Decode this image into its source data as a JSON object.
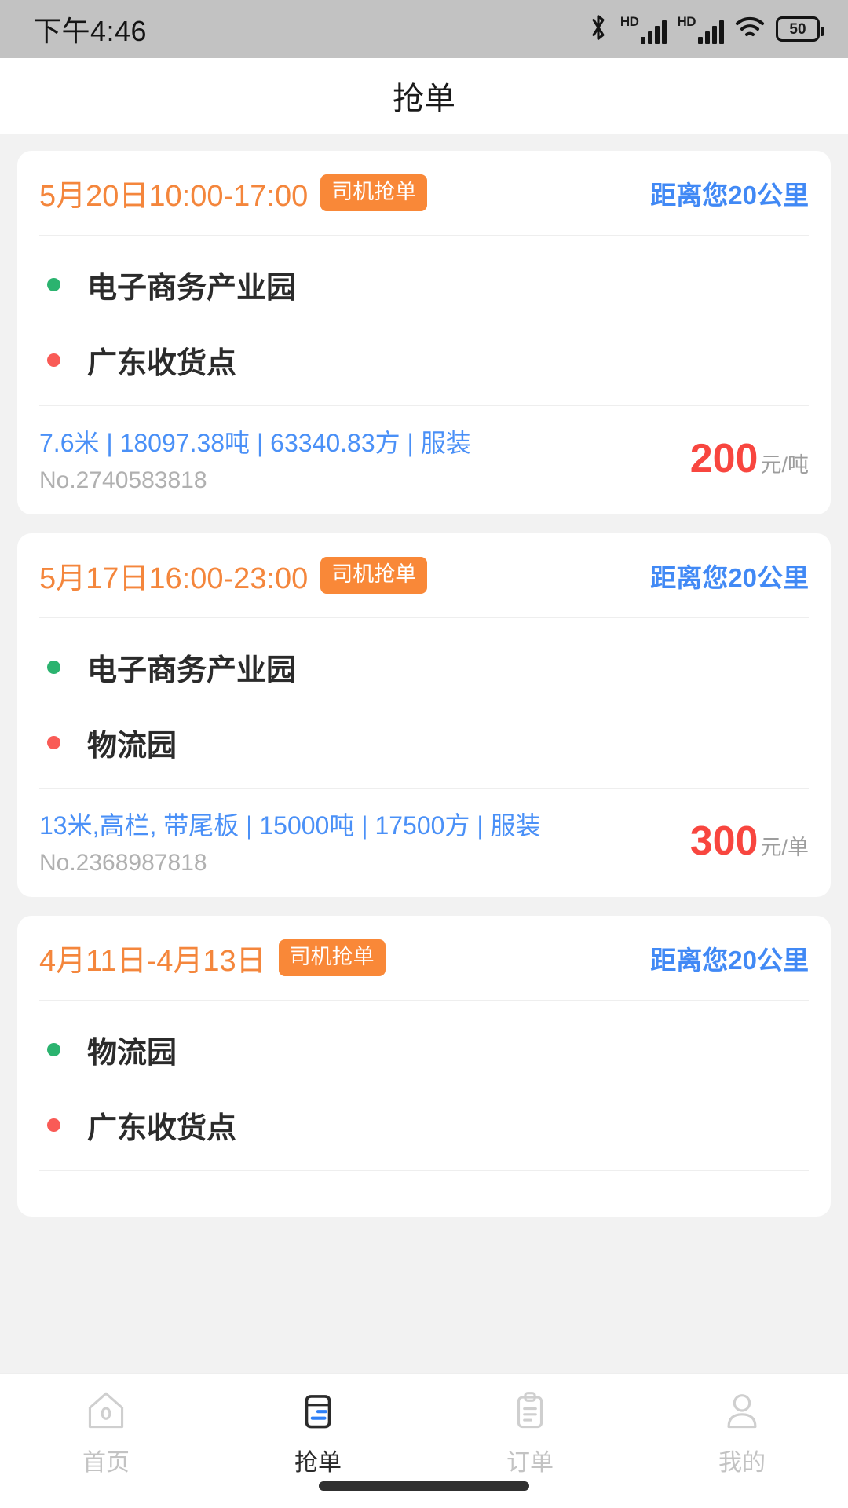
{
  "status_bar": {
    "time": "下午4:46",
    "battery_level": "50",
    "hd_label_1": "HD",
    "hd_label_2": "HD",
    "icons": [
      "bluetooth-icon",
      "hd-signal-icon",
      "hd-signal-icon",
      "wifi-icon",
      "battery-icon"
    ]
  },
  "header": {
    "title": "抢单"
  },
  "colors": {
    "accent_orange": "#f98838",
    "date_orange": "#f4863c",
    "link_blue": "#4a90f7",
    "distance_blue": "#4189f5",
    "price_red": "#f8463f",
    "origin_dot_green": "#2bb36f",
    "dest_dot_red": "#f95b56",
    "page_background": "#f2f2f2",
    "card_background": "#ffffff",
    "status_bar_background": "#c2c2c2"
  },
  "orders": [
    {
      "date": "5月20日10:00-17:00",
      "badge": "司机抢单",
      "distance": "距离您20公里",
      "origin": "电子商务产业园",
      "destination": "广东收货点",
      "spec": "7.6米 | 18097.38吨 | 63340.83方 | 服装",
      "order_no": "No.2740583818",
      "price_value": "200",
      "price_unit": "元/吨"
    },
    {
      "date": "5月17日16:00-23:00",
      "badge": "司机抢单",
      "distance": "距离您20公里",
      "origin": "电子商务产业园",
      "destination": "物流园",
      "spec": "13米,高栏, 带尾板 | 15000吨 | 17500方 | 服装",
      "order_no": "No.2368987818",
      "price_value": "300",
      "price_unit": "元/单"
    },
    {
      "date": "4月11日-4月13日",
      "badge": "司机抢单",
      "distance": "距离您20公里",
      "origin": "物流园",
      "destination": "广东收货点",
      "spec": "",
      "order_no": "",
      "price_value": "",
      "price_unit": ""
    }
  ],
  "tabbar": {
    "items": [
      {
        "label": "首页",
        "icon": "home-icon",
        "active": false
      },
      {
        "label": "抢单",
        "icon": "order-grab-box-icon",
        "active": true
      },
      {
        "label": "订单",
        "icon": "clipboard-icon",
        "active": false
      },
      {
        "label": "我的",
        "icon": "person-icon",
        "active": false
      }
    ]
  }
}
